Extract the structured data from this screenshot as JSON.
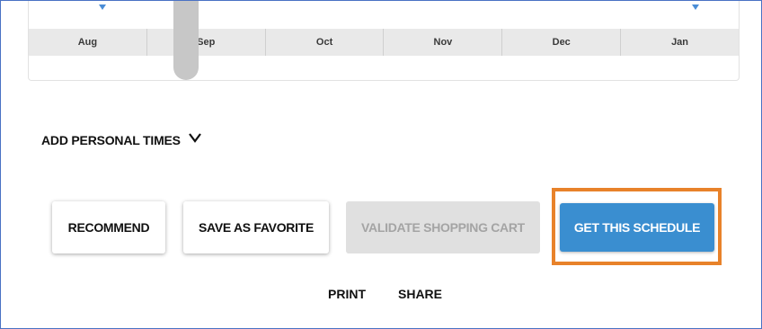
{
  "timeline": {
    "months": [
      "Aug",
      "Sep",
      "Oct",
      "Nov",
      "Dec",
      "Jan"
    ]
  },
  "add_personal_times": {
    "label": "ADD PERSONAL TIMES",
    "icon": "chevron-down-icon"
  },
  "actions": {
    "recommend": "RECOMMEND",
    "save_favorite": "SAVE AS FAVORITE",
    "validate_cart": "VALIDATE SHOPPING CART",
    "get_schedule": "GET THIS SCHEDULE"
  },
  "footer": {
    "print": "PRINT",
    "share": "SHARE"
  },
  "colors": {
    "primary": "#3a8ed0",
    "highlight": "#e8822a",
    "disabled_bg": "#e0e0e0",
    "disabled_text": "#a4a4a4"
  }
}
